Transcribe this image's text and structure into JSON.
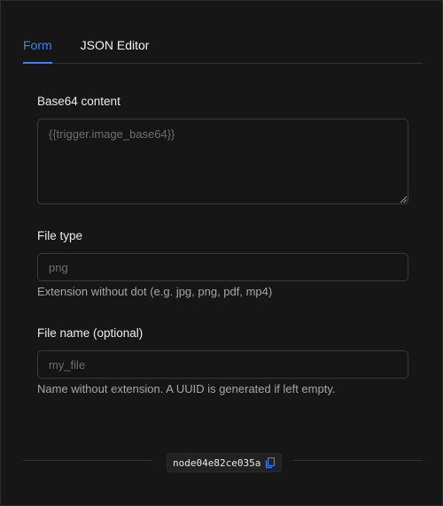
{
  "tabs": [
    {
      "label": "Form",
      "active": true
    },
    {
      "label": "JSON Editor",
      "active": false
    }
  ],
  "fields": {
    "base64": {
      "label": "Base64 content",
      "placeholder": "{{trigger.image_base64}}",
      "value": ""
    },
    "file_type": {
      "label": "File type",
      "placeholder": "png",
      "value": "",
      "hint": "Extension without dot (e.g. jpg, png, pdf, mp4)"
    },
    "file_name": {
      "label": "File name (optional)",
      "placeholder": "my_file",
      "value": "",
      "hint": "Name without extension. A UUID is generated if left empty."
    }
  },
  "footer": {
    "node_id": "node04e82ce035a",
    "copy_icon": "copy-icon"
  },
  "colors": {
    "accent": "#3b82f6",
    "background": "#161616",
    "border": "#3a3a3a"
  }
}
